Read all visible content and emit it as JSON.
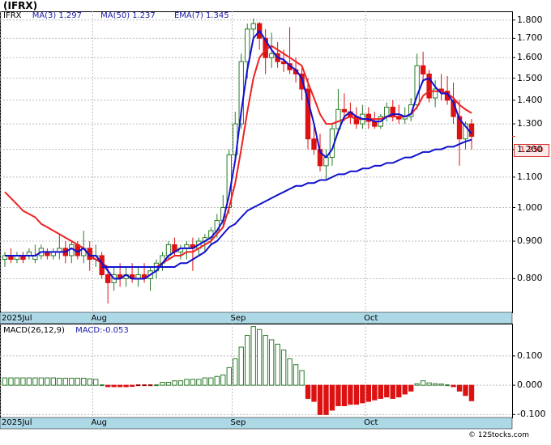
{
  "header": {
    "ticker": "(IFRX)",
    "legend_symbol": "IFRX",
    "ma3_label": "MA(3)",
    "ma3_value": "1.297",
    "ma50_label": "MA(50)",
    "ma50_value": "1.237",
    "ema7_label": "EMA(7)",
    "ema7_value": "1.345",
    "macd_params": "MACD(26,12,9)",
    "macd_value": "MACD:-0.053"
  },
  "last_price_tag": "1.250",
  "credit": "© 12Stocks.com",
  "price_axis": [
    "1.800",
    "1.700",
    "1.600",
    "1.500",
    "1.400",
    "1.300",
    "1.200",
    "1.100",
    "1.000",
    "0.900",
    "0.800"
  ],
  "macd_axis": [
    "0.100",
    "0.000",
    "-0.100"
  ],
  "month_labels": [
    "2025Jul",
    "Aug",
    "Sep",
    "Oct"
  ],
  "colors": {
    "up": "#2a7a2a",
    "down": "#dd1111",
    "ma_short": "#1010d0",
    "ema": "#ee2222",
    "axis_bar": "#add8e6"
  },
  "chart_data": [
    {
      "type": "candlestick",
      "title": "IFRX",
      "ylim": [
        0.72,
        1.85
      ],
      "yscale": "log",
      "candles": [
        [
          0.85,
          0.87,
          0.83,
          0.86
        ],
        [
          0.86,
          0.88,
          0.84,
          0.85
        ],
        [
          0.85,
          0.87,
          0.84,
          0.86
        ],
        [
          0.86,
          0.87,
          0.84,
          0.85
        ],
        [
          0.86,
          0.88,
          0.85,
          0.87
        ],
        [
          0.85,
          0.89,
          0.84,
          0.86
        ],
        [
          0.86,
          0.89,
          0.85,
          0.88
        ],
        [
          0.87,
          0.88,
          0.85,
          0.86
        ],
        [
          0.86,
          0.88,
          0.85,
          0.87
        ],
        [
          0.87,
          0.92,
          0.85,
          0.88
        ],
        [
          0.88,
          0.9,
          0.84,
          0.86
        ],
        [
          0.86,
          0.9,
          0.84,
          0.89
        ],
        [
          0.89,
          0.9,
          0.85,
          0.86
        ],
        [
          0.86,
          0.93,
          0.84,
          0.88
        ],
        [
          0.88,
          0.9,
          0.82,
          0.85
        ],
        [
          0.85,
          0.89,
          0.83,
          0.86
        ],
        [
          0.86,
          0.87,
          0.8,
          0.81
        ],
        [
          0.81,
          0.83,
          0.74,
          0.79
        ],
        [
          0.79,
          0.83,
          0.77,
          0.81
        ],
        [
          0.81,
          0.84,
          0.78,
          0.8
        ],
        [
          0.8,
          0.83,
          0.78,
          0.81
        ],
        [
          0.81,
          0.84,
          0.79,
          0.8
        ],
        [
          0.8,
          0.83,
          0.78,
          0.81
        ],
        [
          0.81,
          0.84,
          0.79,
          0.8
        ],
        [
          0.8,
          0.83,
          0.77,
          0.82
        ],
        [
          0.82,
          0.85,
          0.8,
          0.84
        ],
        [
          0.84,
          0.87,
          0.82,
          0.86
        ],
        [
          0.86,
          0.9,
          0.85,
          0.89
        ],
        [
          0.89,
          0.91,
          0.86,
          0.87
        ],
        [
          0.87,
          0.89,
          0.85,
          0.88
        ],
        [
          0.88,
          0.9,
          0.85,
          0.89
        ],
        [
          0.89,
          0.91,
          0.82,
          0.88
        ],
        [
          0.88,
          0.91,
          0.86,
          0.9
        ],
        [
          0.9,
          0.92,
          0.87,
          0.91
        ],
        [
          0.91,
          0.94,
          0.89,
          0.93
        ],
        [
          0.93,
          0.98,
          0.91,
          0.96
        ],
        [
          0.96,
          1.04,
          0.94,
          1.0
        ],
        [
          1.0,
          1.2,
          0.98,
          1.18
        ],
        [
          1.18,
          1.35,
          1.16,
          1.3
        ],
        [
          1.3,
          1.62,
          1.28,
          1.58
        ],
        [
          1.58,
          1.78,
          1.5,
          1.75
        ],
        [
          1.75,
          1.81,
          1.7,
          1.78
        ],
        [
          1.78,
          1.79,
          1.64,
          1.7
        ],
        [
          1.7,
          1.75,
          1.52,
          1.6
        ],
        [
          1.6,
          1.73,
          1.55,
          1.62
        ],
        [
          1.62,
          1.68,
          1.55,
          1.58
        ],
        [
          1.58,
          1.64,
          1.53,
          1.57
        ],
        [
          1.57,
          1.76,
          1.52,
          1.54
        ],
        [
          1.54,
          1.6,
          1.48,
          1.52
        ],
        [
          1.52,
          1.55,
          1.4,
          1.45
        ],
        [
          1.45,
          1.5,
          1.2,
          1.24
        ],
        [
          1.24,
          1.3,
          1.18,
          1.2
        ],
        [
          1.2,
          1.26,
          1.12,
          1.14
        ],
        [
          1.14,
          1.2,
          1.09,
          1.17
        ],
        [
          1.17,
          1.3,
          1.14,
          1.28
        ],
        [
          1.28,
          1.45,
          1.26,
          1.36
        ],
        [
          1.36,
          1.43,
          1.31,
          1.35
        ],
        [
          1.35,
          1.39,
          1.3,
          1.33
        ],
        [
          1.33,
          1.37,
          1.28,
          1.3
        ],
        [
          1.3,
          1.38,
          1.28,
          1.34
        ],
        [
          1.34,
          1.37,
          1.28,
          1.31
        ],
        [
          1.31,
          1.35,
          1.28,
          1.29
        ],
        [
          1.29,
          1.34,
          1.28,
          1.33
        ],
        [
          1.33,
          1.39,
          1.31,
          1.37
        ],
        [
          1.37,
          1.4,
          1.31,
          1.33
        ],
        [
          1.33,
          1.38,
          1.3,
          1.32
        ],
        [
          1.32,
          1.37,
          1.3,
          1.33
        ],
        [
          1.33,
          1.41,
          1.31,
          1.38
        ],
        [
          1.38,
          1.62,
          1.36,
          1.56
        ],
        [
          1.56,
          1.63,
          1.48,
          1.52
        ],
        [
          1.52,
          1.54,
          1.39,
          1.41
        ],
        [
          1.41,
          1.49,
          1.37,
          1.45
        ],
        [
          1.45,
          1.52,
          1.4,
          1.44
        ],
        [
          1.44,
          1.51,
          1.38,
          1.4
        ],
        [
          1.4,
          1.48,
          1.3,
          1.33
        ],
        [
          1.33,
          1.4,
          1.14,
          1.24
        ],
        [
          1.24,
          1.31,
          1.2,
          1.3
        ],
        [
          1.3,
          1.32,
          1.2,
          1.25
        ]
      ],
      "ma3": [
        0.86,
        0.86,
        0.86,
        0.86,
        0.86,
        0.86,
        0.87,
        0.87,
        0.87,
        0.87,
        0.87,
        0.88,
        0.87,
        0.88,
        0.86,
        0.86,
        0.84,
        0.82,
        0.8,
        0.8,
        0.81,
        0.8,
        0.8,
        0.8,
        0.81,
        0.82,
        0.84,
        0.86,
        0.87,
        0.88,
        0.88,
        0.88,
        0.89,
        0.9,
        0.91,
        0.93,
        0.96,
        1.04,
        1.16,
        1.35,
        1.54,
        1.7,
        1.74,
        1.69,
        1.64,
        1.6,
        1.59,
        1.56,
        1.54,
        1.5,
        1.4,
        1.3,
        1.19,
        1.17,
        1.2,
        1.27,
        1.33,
        1.35,
        1.33,
        1.32,
        1.32,
        1.31,
        1.31,
        1.33,
        1.34,
        1.34,
        1.33,
        1.34,
        1.42,
        1.49,
        1.5,
        1.46,
        1.43,
        1.43,
        1.39,
        1.32,
        1.29,
        1.26
      ],
      "ma50": [
        null,
        null,
        null,
        null,
        null,
        null,
        null,
        null,
        null,
        null,
        null,
        null,
        null,
        null,
        null,
        null,
        0.83,
        0.83,
        0.83,
        0.83,
        0.83,
        0.83,
        0.83,
        0.83,
        0.83,
        0.83,
        0.83,
        0.83,
        0.83,
        0.84,
        0.84,
        0.85,
        0.86,
        0.87,
        0.89,
        0.9,
        0.92,
        0.94,
        0.95,
        0.97,
        0.99,
        1.0,
        1.01,
        1.02,
        1.03,
        1.04,
        1.05,
        1.06,
        1.07,
        1.07,
        1.08,
        1.08,
        1.09,
        1.09,
        1.1,
        1.11,
        1.11,
        1.12,
        1.12,
        1.13,
        1.13,
        1.14,
        1.14,
        1.15,
        1.15,
        1.16,
        1.17,
        1.17,
        1.18,
        1.19,
        1.19,
        1.2,
        1.2,
        1.21,
        1.21,
        1.22,
        1.23,
        1.237
      ],
      "ema7": [
        1.05,
        1.03,
        1.01,
        0.99,
        0.98,
        0.97,
        0.95,
        0.94,
        0.93,
        0.92,
        0.91,
        0.9,
        0.89,
        0.88,
        0.86,
        0.85,
        0.84,
        0.83,
        0.83,
        0.83,
        0.83,
        0.83,
        0.83,
        0.83,
        0.83,
        0.83,
        0.84,
        0.85,
        0.86,
        0.86,
        0.87,
        0.87,
        0.88,
        0.89,
        0.9,
        0.92,
        0.94,
        1.0,
        1.08,
        1.2,
        1.35,
        1.5,
        1.6,
        1.64,
        1.66,
        1.64,
        1.62,
        1.6,
        1.58,
        1.56,
        1.48,
        1.41,
        1.34,
        1.3,
        1.3,
        1.31,
        1.32,
        1.33,
        1.32,
        1.32,
        1.32,
        1.32,
        1.32,
        1.33,
        1.33,
        1.33,
        1.33,
        1.34,
        1.37,
        1.42,
        1.44,
        1.44,
        1.44,
        1.43,
        1.41,
        1.38,
        1.36,
        1.345
      ]
    },
    {
      "type": "bar",
      "title": "MACD(26,12,9)",
      "ylim": [
        -0.11,
        0.21
      ],
      "values": [
        0.025,
        0.025,
        0.025,
        0.025,
        0.025,
        0.025,
        0.025,
        0.025,
        0.025,
        0.024,
        0.024,
        0.024,
        0.024,
        0.024,
        0.022,
        0.02,
        0.0,
        -0.005,
        -0.005,
        -0.005,
        -0.005,
        -0.004,
        -0.003,
        -0.003,
        -0.002,
        0.0,
        0.01,
        0.01,
        0.015,
        0.015,
        0.02,
        0.02,
        0.02,
        0.025,
        0.025,
        0.03,
        0.035,
        0.06,
        0.09,
        0.13,
        0.17,
        0.2,
        0.19,
        0.17,
        0.155,
        0.14,
        0.12,
        0.09,
        0.07,
        0.05,
        -0.045,
        -0.055,
        -0.1,
        -0.1,
        -0.085,
        -0.07,
        -0.07,
        -0.065,
        -0.065,
        -0.06,
        -0.055,
        -0.05,
        -0.045,
        -0.04,
        -0.045,
        -0.04,
        -0.03,
        -0.02,
        0.005,
        0.015,
        0.008,
        0.005,
        0.004,
        0.003,
        -0.005,
        -0.02,
        -0.035,
        -0.053
      ]
    }
  ]
}
